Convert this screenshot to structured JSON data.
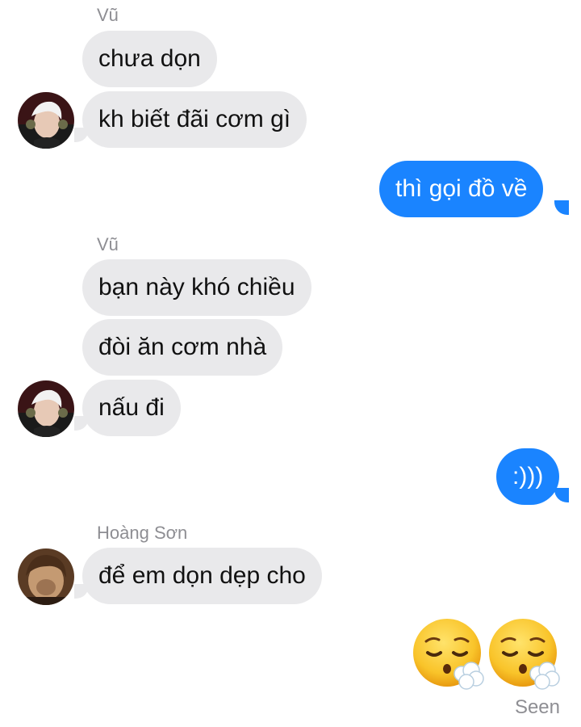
{
  "conversation": {
    "groups": [
      {
        "sender": "Vũ",
        "messages": [
          "chưa dọn",
          "kh biết đãi cơm gì"
        ]
      },
      {
        "me": [
          "thì gọi đồ về"
        ]
      },
      {
        "sender": "Vũ",
        "messages": [
          "bạn này khó chiều",
          "đòi ăn cơm nhà",
          "nấu đi"
        ]
      },
      {
        "me": [
          ":)))"
        ]
      },
      {
        "sender": "Hoàng Sơn",
        "messages": [
          "để em dọn dẹp cho"
        ]
      }
    ],
    "emoji_reactions": [
      "face-with-steam-from-nose-emoji",
      "face-with-steam-from-nose-emoji"
    ],
    "status": "Seen"
  },
  "colors": {
    "incoming_bubble": "#e9e9eb",
    "outgoing_bubble": "#1a84ff",
    "sender_label": "#8e8e93"
  }
}
